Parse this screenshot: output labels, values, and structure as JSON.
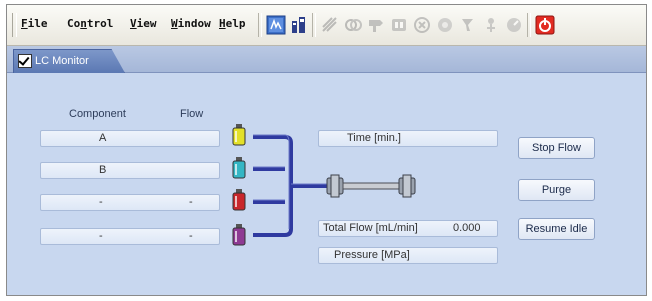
{
  "menu": [
    {
      "first": "F",
      "rest": "ile"
    },
    {
      "first": "Co",
      "ul": "n",
      "rest": "trol"
    },
    {
      "first": "V",
      "rest": "iew"
    },
    {
      "first": "W",
      "rest": "indow"
    },
    {
      "first": "H",
      "rest": "elp"
    }
  ],
  "toolbar": {
    "icons": [
      "monitor-icon",
      "analysis-icon",
      "method-icon",
      "link-icon",
      "probe-icon",
      "vial-tray-icon",
      "stop-circle-icon",
      "settings-icon",
      "tool-icon",
      "valve-icon",
      "gauge-icon",
      "power-icon"
    ]
  },
  "tab": {
    "label": "LC Monitor"
  },
  "panel": {
    "component_header": "Component",
    "flow_header": "Flow",
    "components": [
      {
        "name": "A",
        "flow": ""
      },
      {
        "name": "B",
        "flow": ""
      },
      {
        "name": "-",
        "flow": "-"
      },
      {
        "name": "-",
        "flow": "-"
      }
    ],
    "bottle_colors": [
      "#e3e02a",
      "#34b6c4",
      "#c8262b",
      "#8e3a93"
    ],
    "time_label": "Time [min.]",
    "total_flow_label": "Total Flow [mL/min]",
    "total_flow_value": "0.000",
    "pressure_label": "Pressure [MPa]",
    "buttons": {
      "stop_flow": "Stop Flow",
      "purge": "Purge",
      "resume_idle": "Resume Idle"
    }
  },
  "colors": {
    "pipe": "#2f3aa0",
    "panel": "#c8d7ef",
    "tab": "#5b78b3"
  }
}
